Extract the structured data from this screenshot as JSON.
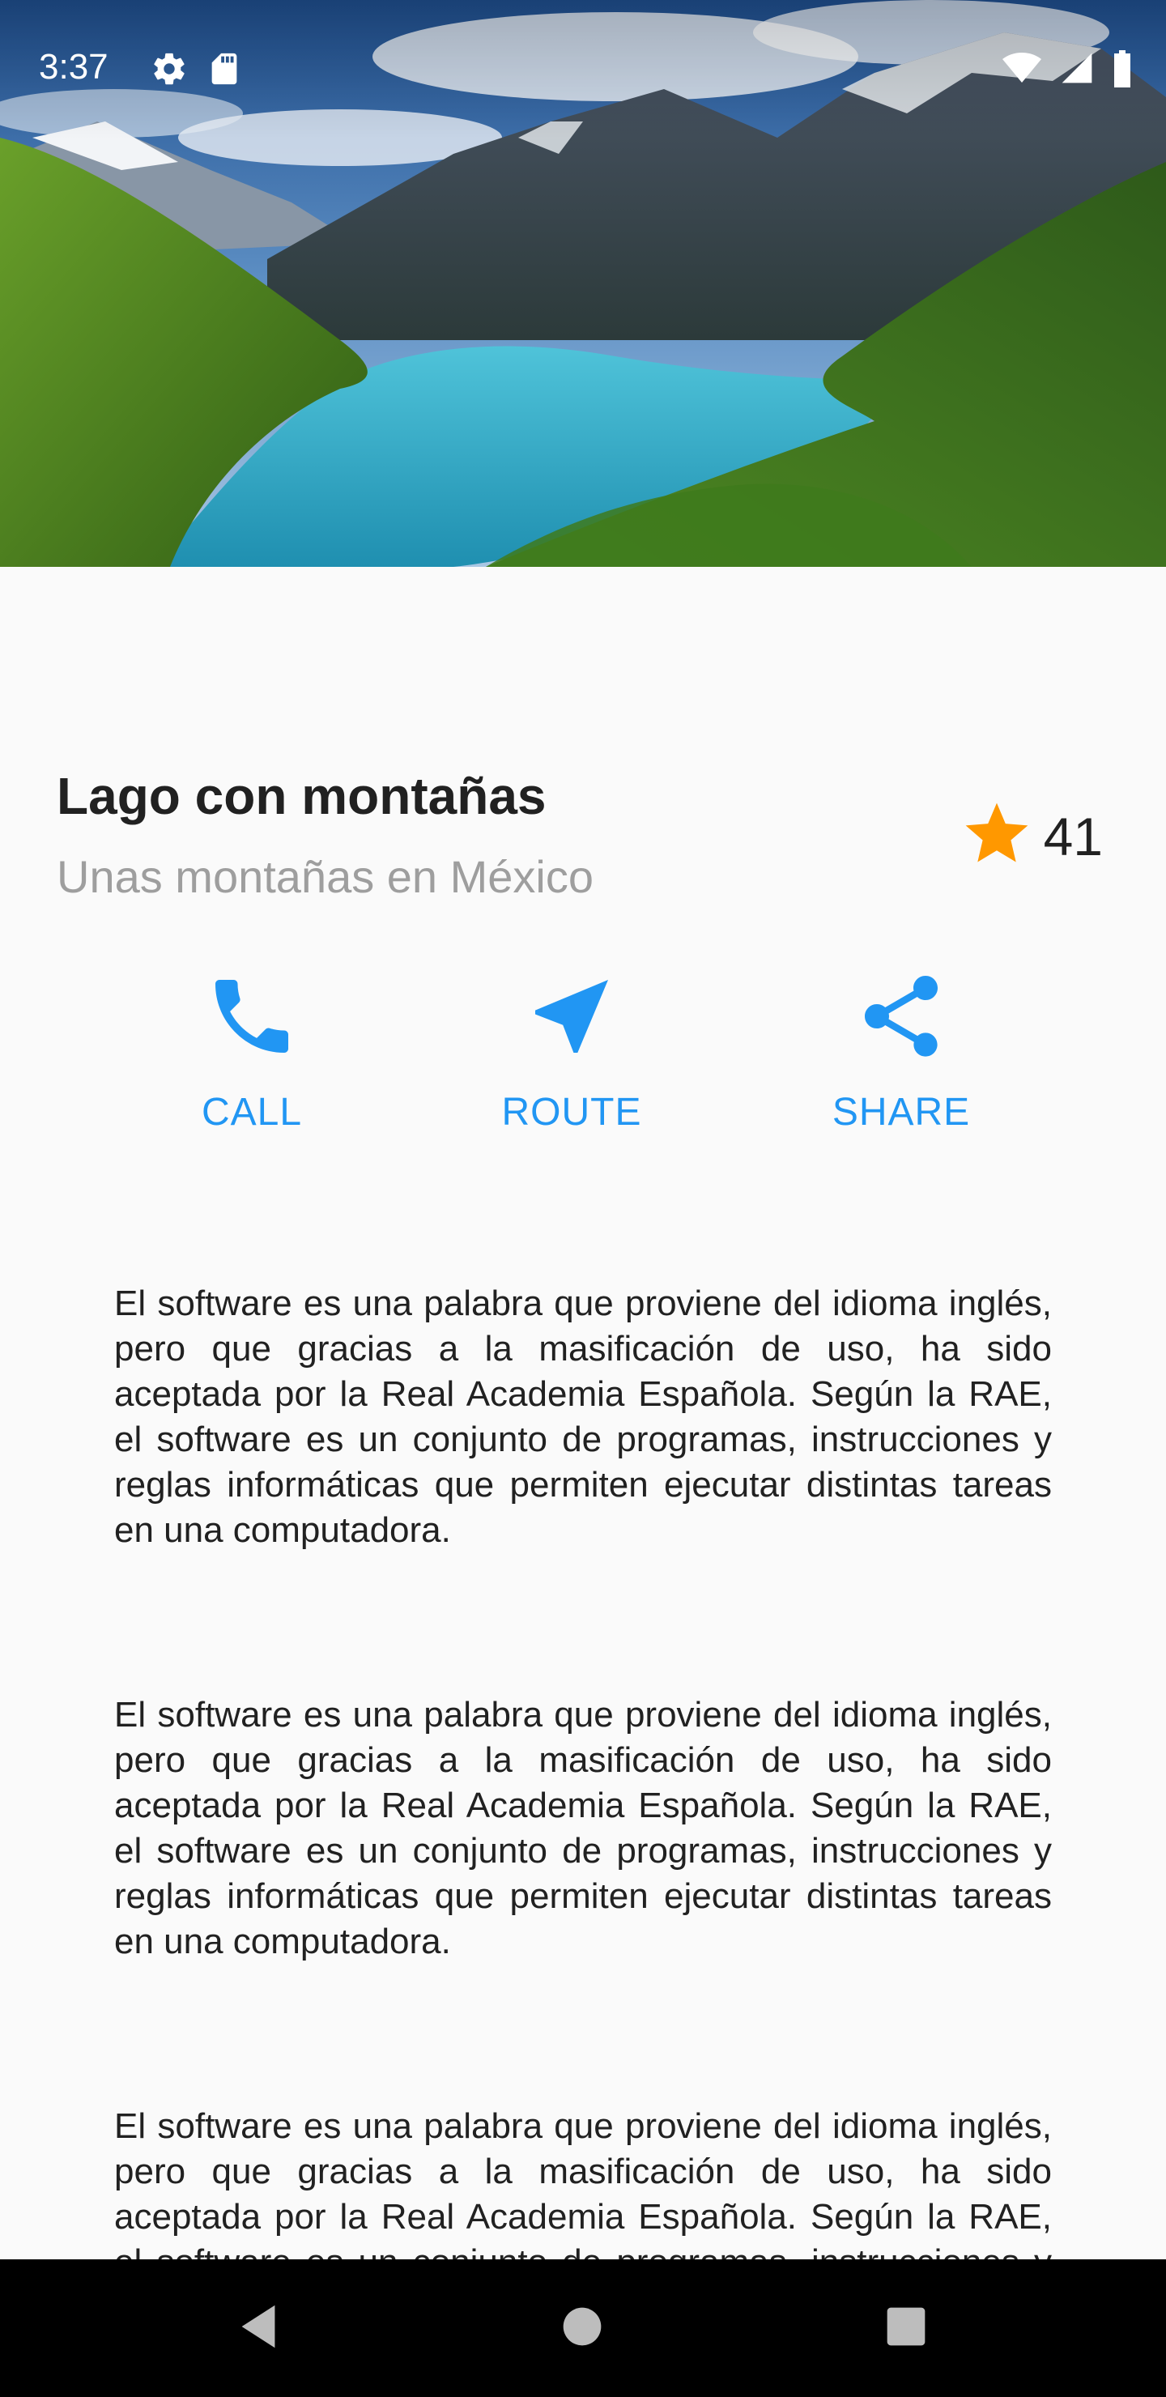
{
  "status_bar": {
    "time": "3:37",
    "left_icons": [
      "settings-icon",
      "sd-card-icon"
    ],
    "right_icons": [
      "wifi-icon",
      "signal-icon",
      "battery-icon"
    ]
  },
  "hero": {
    "image": "mountain-lake-photo"
  },
  "place": {
    "title": "Lago con montañas",
    "subtitle": "Unas montañas en México",
    "rating": "41",
    "rating_icon": "star-icon",
    "rating_color": "#ff9800"
  },
  "actions": {
    "accent": "#2196f3",
    "call": {
      "label": "CALL",
      "icon": "phone-icon"
    },
    "route": {
      "label": "ROUTE",
      "icon": "navigation-icon"
    },
    "share": {
      "label": "SHARE",
      "icon": "share-icon"
    }
  },
  "content": {
    "paragraphs": [
      "El software es una palabra que proviene del idioma inglés, pero que gracias a la masificación de uso, ha sido aceptada por la Real Academia Española. Según la RAE, el software es un conjunto de programas, instrucciones y reglas informáticas que permiten ejecutar distintas tareas en una computadora.",
      "El software es una palabra que proviene del idioma inglés, pero que gracias a la masificación de uso, ha sido aceptada por la Real Academia Española. Según la RAE, el software es un conjunto de programas, instrucciones y reglas informáticas que permiten ejecutar distintas tareas en una computadora.",
      "El software es una palabra que proviene del idioma inglés, pero que gracias a la masificación de uso, ha sido aceptada por la Real Academia Española. Según la RAE, el software es un conjunto de programas, instrucciones y reglas informáticas que permiten ejecutar distintas tareas en una computadora."
    ]
  },
  "nav_bar": {
    "buttons": [
      "back-icon",
      "home-icon",
      "recents-icon"
    ]
  }
}
